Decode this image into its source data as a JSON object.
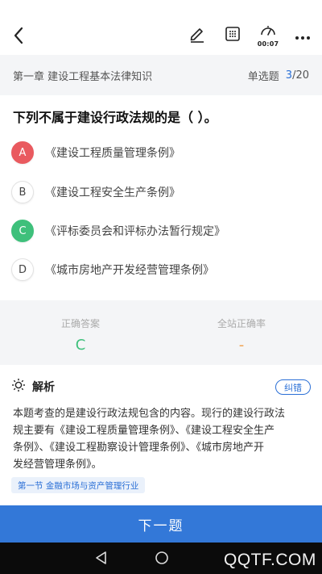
{
  "header": {
    "icons": [
      "back-arrow-icon",
      "edit-icon",
      "answer-card-icon",
      "timer-icon",
      "more-icon"
    ],
    "timer": "00:07"
  },
  "subheader": {
    "chapter": "第一章 建设工程基本法律知识",
    "question_type": "单选题",
    "current": "3",
    "total": "/20"
  },
  "question": {
    "text": "下列不属于建设行政法规的是（ ）。",
    "options": [
      {
        "letter": "A",
        "text": "《建设工程质量管理条例》",
        "state": "wrong"
      },
      {
        "letter": "B",
        "text": "《建设工程安全生产条例》",
        "state": "normal"
      },
      {
        "letter": "C",
        "text": "《评标委员会和评标办法暂行规定》",
        "state": "correct"
      },
      {
        "letter": "D",
        "text": "《城市房地产开发经营管理条例》",
        "state": "normal"
      }
    ]
  },
  "answer": {
    "correct_label": "正确答案",
    "correct_value": "C",
    "rate_label": "全站正确率",
    "rate_value": "-"
  },
  "analysis": {
    "title": "解析",
    "report_label": "纠错",
    "lines": [
      "本题考查的是建设行政法规包含的内容。现行的建设行政法",
      "规主要有《建设工程质量管理条例》、《建设工程安全生产",
      "条例》、《建设工程勘察设计管理条例》、《城市房地产开",
      "发经营管理条例》。"
    ],
    "tag": "第一节 金融市场与资产管理行业"
  },
  "footer": {
    "next_label": "下一题"
  },
  "watermark": "QQTF.COM",
  "colors": {
    "accent": "#3378d8",
    "wrong": "#e95a5f",
    "correct": "#3ec07b",
    "rate": "#f0a04b"
  }
}
